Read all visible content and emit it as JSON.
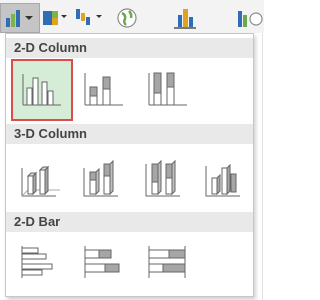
{
  "ribbon": {
    "buttons": [
      {
        "name": "insert-column-chart",
        "icon": "column-chart-icon",
        "selected": true
      },
      {
        "name": "insert-hierarchy-chart",
        "icon": "hierarchy-chart-icon"
      },
      {
        "name": "insert-waterfall-chart",
        "icon": "waterfall-chart-icon"
      },
      {
        "name": "maps",
        "icon": "globe-icon"
      },
      {
        "name": "pivotchart",
        "icon": "pivot-chart-icon"
      },
      {
        "name": "3d-map",
        "icon": "map-icon"
      }
    ]
  },
  "gallery": {
    "sections": [
      {
        "title": "2-D Column",
        "items": [
          {
            "name": "clustered-column",
            "selected": true
          },
          {
            "name": "stacked-column"
          },
          {
            "name": "100-stacked-column"
          }
        ]
      },
      {
        "title": "3-D Column",
        "items": [
          {
            "name": "3d-clustered-column"
          },
          {
            "name": "3d-stacked-column"
          },
          {
            "name": "3d-100-stacked-column"
          },
          {
            "name": "3d-column"
          }
        ]
      },
      {
        "title": "2-D Bar",
        "items": [
          {
            "name": "clustered-bar"
          },
          {
            "name": "stacked-bar"
          },
          {
            "name": "100-stacked-bar"
          }
        ]
      }
    ]
  },
  "colors": {
    "accent_selected_border": "#e04a4a",
    "accent_selected_fill": "#d5ecd7",
    "header_bg": "#e9e9e9",
    "icon_gray": "#a6a6a6",
    "icon_dark": "#555555"
  }
}
